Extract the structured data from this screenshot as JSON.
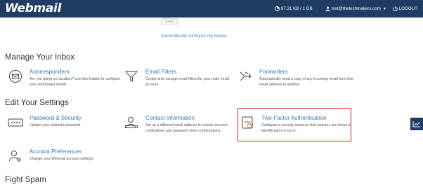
{
  "header": {
    "logo": "Webmail",
    "disk_usage": "87.31 KB / 1 GB",
    "user_email": "test@thetechmakers.com",
    "logout_label": "LOGOUT"
  },
  "send_area": {
    "send_label": "Send",
    "auto_config_link": "Automatically configure my device"
  },
  "sections": {
    "manage_inbox": "Manage Your Inbox",
    "edit_settings": "Edit Your Settings",
    "fight_spam": "Fight Spam"
  },
  "cards": {
    "autoresponders": {
      "title": "Autoresponders",
      "desc": "Are you going on vacation? Use this feature to configure your automated emails."
    },
    "email_filters": {
      "title": "Email Filters",
      "desc": "Create and manage email filters for your main email account."
    },
    "forwarders": {
      "title": "Forwarders",
      "desc": "Automatically send a copy of any incoming email from this email address to another."
    },
    "password_security": {
      "title": "Password & Security",
      "desc": "Update your webmail password."
    },
    "contact_information": {
      "title": "Contact Information",
      "desc": "Set up a different email address to receive account notifications and password reset confirmations."
    },
    "two_factor": {
      "title": "Two-Factor Authentication",
      "desc": "Configure a security measure that requires two forms of identification to log in."
    },
    "account_preferences": {
      "title": "Account Preferences",
      "desc": "Change your Webmail account settings."
    }
  },
  "colors": {
    "header_bg": "#1f3d63",
    "link": "#2e7bbf",
    "highlight": "#e01e1e"
  }
}
